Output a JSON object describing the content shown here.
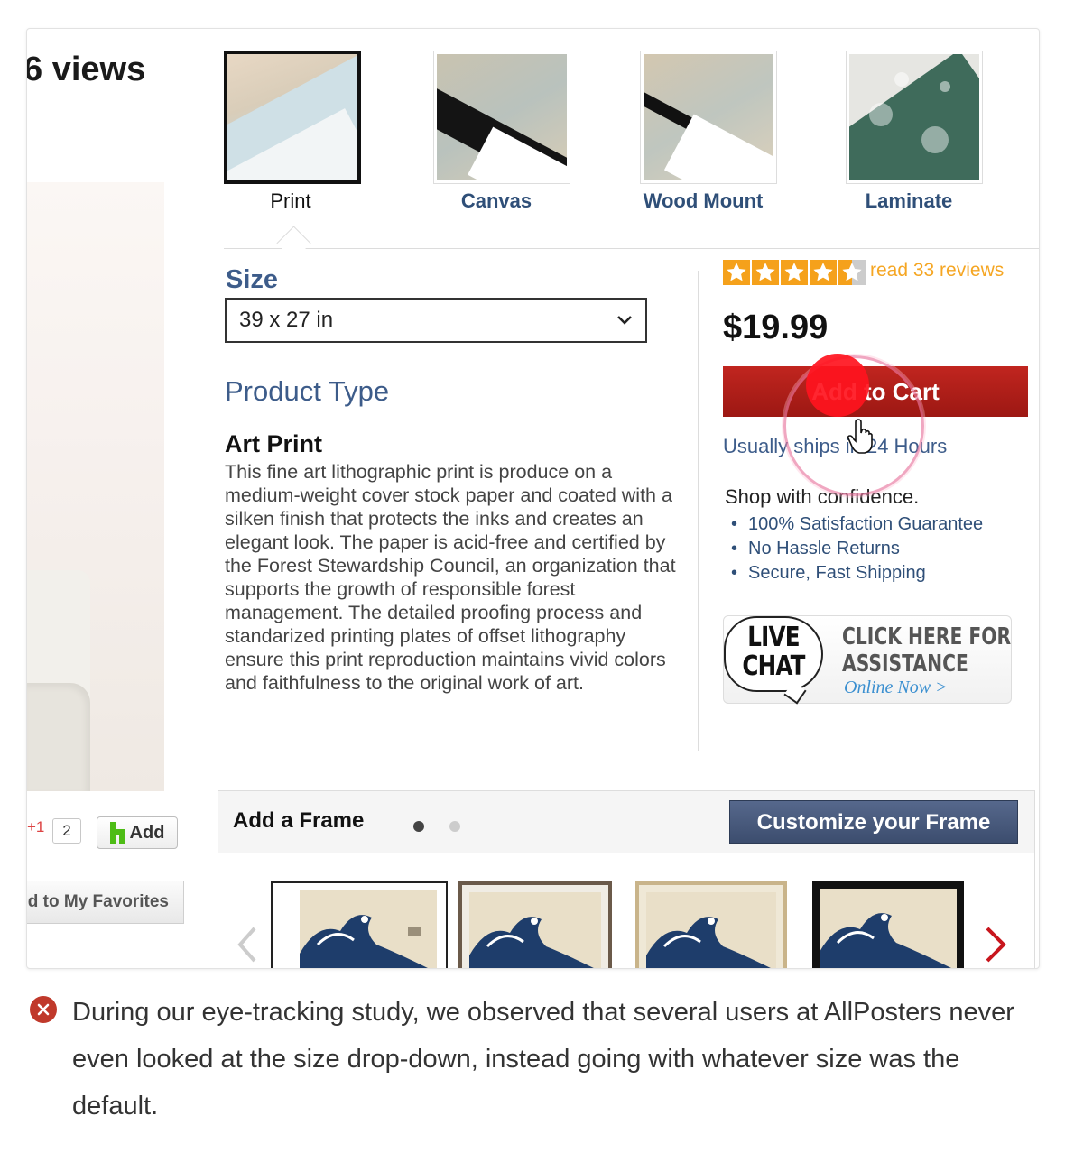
{
  "header": {
    "views_text": "6 views"
  },
  "product_options": [
    {
      "label": "Print",
      "selected": true
    },
    {
      "label": "Canvas",
      "selected": false
    },
    {
      "label": "Wood Mount",
      "selected": false
    },
    {
      "label": "Laminate",
      "selected": false
    }
  ],
  "size": {
    "label": "Size",
    "selected_value": "39 x 27 in"
  },
  "product_type": {
    "label": "Product Type",
    "title": "Art Print",
    "description": "This fine art lithographic print is produce on a medium-weight cover stock paper and coated with a silken finish that protects the inks and creates an elegant look. The paper is acid-free and certified by the Forest Stewardship Council, an organization that supports the growth of responsible forest management. The detailed proofing process and standarized printing plates of offset lithography ensure this print reproduction maintains vivid colors and faithfulness to the original work of art."
  },
  "purchase": {
    "rating_stars": 4.5,
    "reviews_link": "read 33 reviews",
    "price": "$19.99",
    "add_to_cart": "Add to Cart",
    "shipping": "Usually ships in 24 Hours",
    "confidence_heading": "Shop with confidence.",
    "confidence_items": [
      "100% Satisfaction Guarantee",
      "No Hassle Returns",
      "Secure, Fast Shipping"
    ]
  },
  "live_chat": {
    "bubble_line1": "LIVE",
    "bubble_line2": "CHAT",
    "cta_line1": "CLICK HERE FOR",
    "cta_line2": "ASSISTANCE",
    "online": "Online Now >"
  },
  "social": {
    "plus_text": "+1",
    "count": "2",
    "add_label": "Add",
    "favorites_label": "Add to My Favorites"
  },
  "frame": {
    "title": "Add a Frame",
    "customize_button": "Customize your Frame",
    "page_dots": 2,
    "active_dot": 1
  },
  "note": {
    "text": "During our eye-tracking study, we observed that several users at AllPosters never even looked at the size drop-down, instead going with whatever size was the default."
  },
  "colors": {
    "brand_blue": "#3d5c8a",
    "cart_red": "#b31f19",
    "star_orange": "#f5a11b",
    "customize_navy": "#4a5b7d",
    "note_red": "#c0392b"
  }
}
